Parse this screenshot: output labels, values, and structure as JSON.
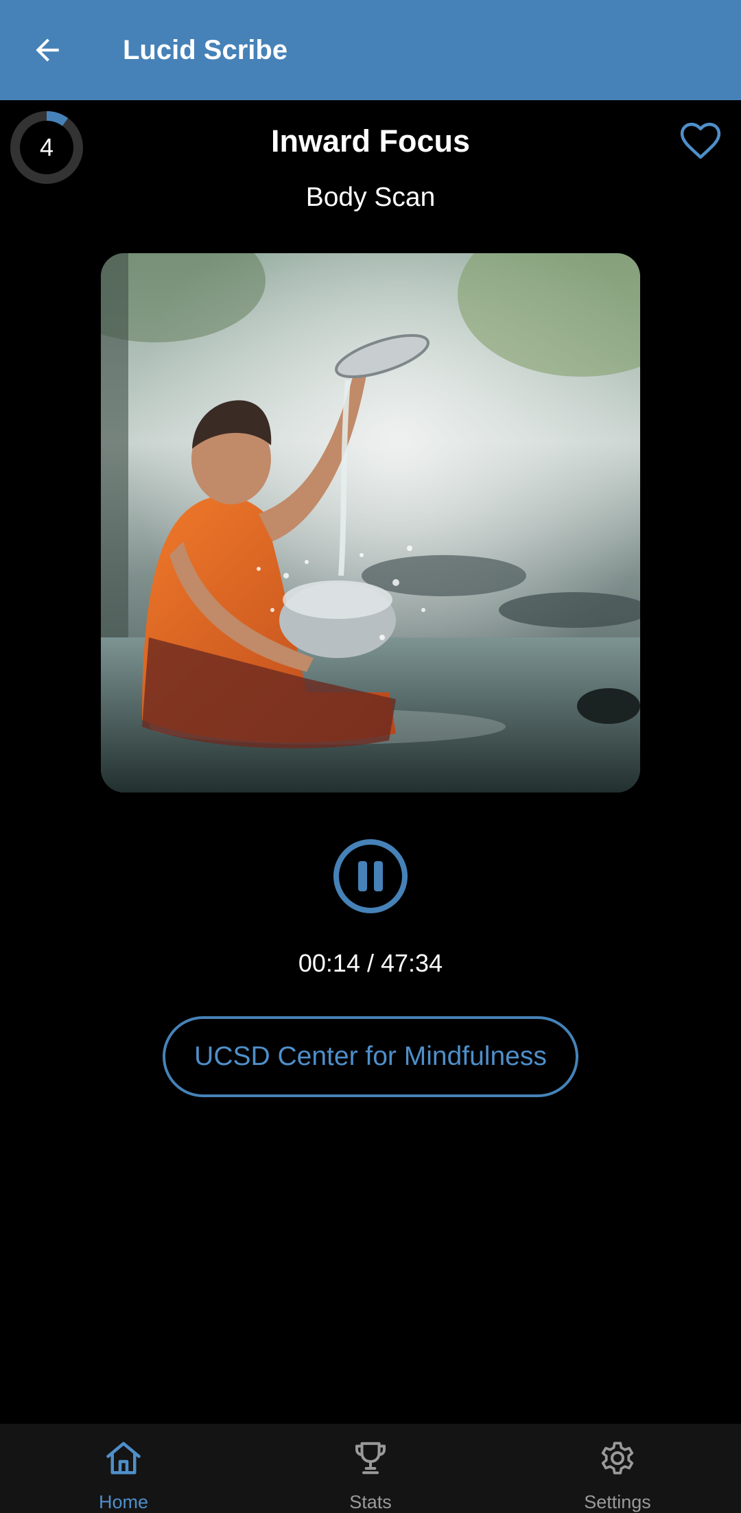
{
  "app_bar": {
    "title": "Lucid Scribe",
    "back_icon": "arrow-left-icon",
    "background_color": "#4682b8"
  },
  "session_counter": {
    "value": "4",
    "progress_fraction": 0.1,
    "ring_color": "#333333",
    "progress_color": "#4682b8"
  },
  "favorite": {
    "icon": "heart-outline-icon",
    "color": "#4f8fca"
  },
  "track": {
    "title": "Inward Focus",
    "subtitle": "Body Scan"
  },
  "artwork": {
    "description_icon": "meditation-artwork-image"
  },
  "player": {
    "control_icon": "pause-icon",
    "elapsed": "00:14",
    "separator": "/",
    "duration": "47:34"
  },
  "source_link": {
    "label": "UCSD Center for Mindfulness"
  },
  "bottom_nav": {
    "items": [
      {
        "label": "Home",
        "icon": "home-icon",
        "active": true
      },
      {
        "label": "Stats",
        "icon": "trophy-icon",
        "active": false
      },
      {
        "label": "Settings",
        "icon": "gear-icon",
        "active": false
      }
    ],
    "active_color": "#4f8fca",
    "inactive_color": "#9a9a9a"
  }
}
